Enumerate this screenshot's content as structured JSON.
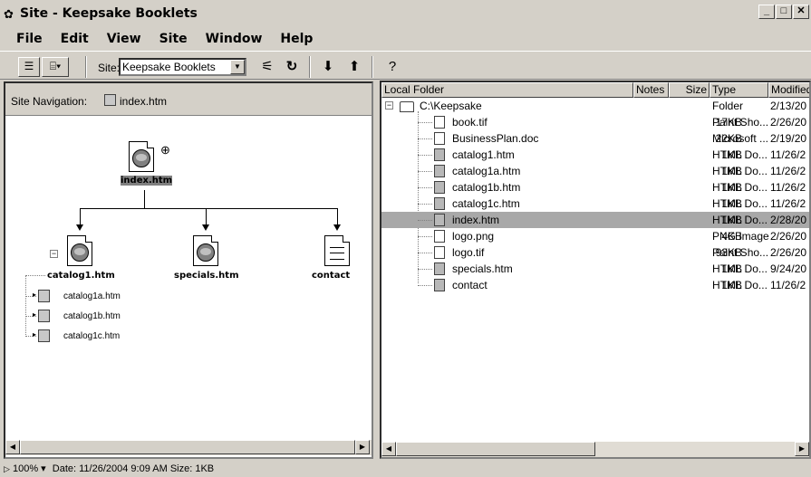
{
  "window": {
    "title": "Site - Keepsake Booklets",
    "app_icon": "flower-icon",
    "buttons": [
      "_",
      "□",
      "✕"
    ]
  },
  "menu": [
    "File",
    "Edit",
    "View",
    "Site",
    "Window",
    "Help"
  ],
  "toolbar": {
    "site_label": "Site:",
    "site_value": "Keepsake Booklets",
    "icons": [
      "files-view-icon",
      "site-map-icon",
      "connect-icon",
      "refresh-icon",
      "get-icon",
      "put-icon",
      "help-icon"
    ]
  },
  "site_nav": {
    "label": "Site Navigation:",
    "file": "index.htm",
    "root": "index.htm",
    "children": [
      "catalog1.htm",
      "specials.htm",
      "contact"
    ],
    "sub_children": [
      "catalog1a.htm",
      "catalog1b.htm",
      "catalog1c.htm"
    ]
  },
  "local_files": {
    "columns": [
      "Local Folder",
      "Notes",
      "Size",
      "Type",
      "Modified"
    ],
    "root": {
      "name": "C:\\Keepsake",
      "type": "Folder",
      "modified": "2/13/20"
    },
    "rows": [
      {
        "name": "book.tif",
        "size": "17KB",
        "type": "Paint Sho...",
        "modified": "2/26/20",
        "icon": "file-icon"
      },
      {
        "name": "BusinessPlan.doc",
        "size": "22KB",
        "type": "Microsoft ...",
        "modified": "2/19/20",
        "icon": "file-icon"
      },
      {
        "name": "catalog1.htm",
        "size": "1KB",
        "type": "HTML Do...",
        "modified": "11/26/2",
        "icon": "html-file-icon"
      },
      {
        "name": "catalog1a.htm",
        "size": "1KB",
        "type": "HTML Do...",
        "modified": "11/26/2",
        "icon": "html-file-icon"
      },
      {
        "name": "catalog1b.htm",
        "size": "1KB",
        "type": "HTML Do...",
        "modified": "11/26/2",
        "icon": "html-file-icon"
      },
      {
        "name": "catalog1c.htm",
        "size": "1KB",
        "type": "HTML Do...",
        "modified": "11/26/2",
        "icon": "html-file-icon"
      },
      {
        "name": "index.htm",
        "size": "1KB",
        "type": "HTML Do...",
        "modified": "2/28/20",
        "icon": "html-file-icon",
        "selected": true
      },
      {
        "name": "logo.png",
        "size": "4KB",
        "type": "PNG Image",
        "modified": "2/26/20",
        "icon": "image-file-icon"
      },
      {
        "name": "logo.tif",
        "size": "93KB",
        "type": "Paint Sho...",
        "modified": "2/26/20",
        "icon": "file-icon"
      },
      {
        "name": "specials.htm",
        "size": "1KB",
        "type": "HTML Do...",
        "modified": "9/24/20",
        "icon": "html-file-icon"
      },
      {
        "name": "contact",
        "size": "1KB",
        "type": "HTML Do...",
        "modified": "11/26/2",
        "icon": "html-file-icon"
      }
    ]
  },
  "status": {
    "zoom": "100%",
    "text": "Date: 11/26/2004 9:09 AM  Size: 1KB"
  },
  "colors": {
    "chrome": "#d4d0c8",
    "selection": "#a8a8a8"
  }
}
